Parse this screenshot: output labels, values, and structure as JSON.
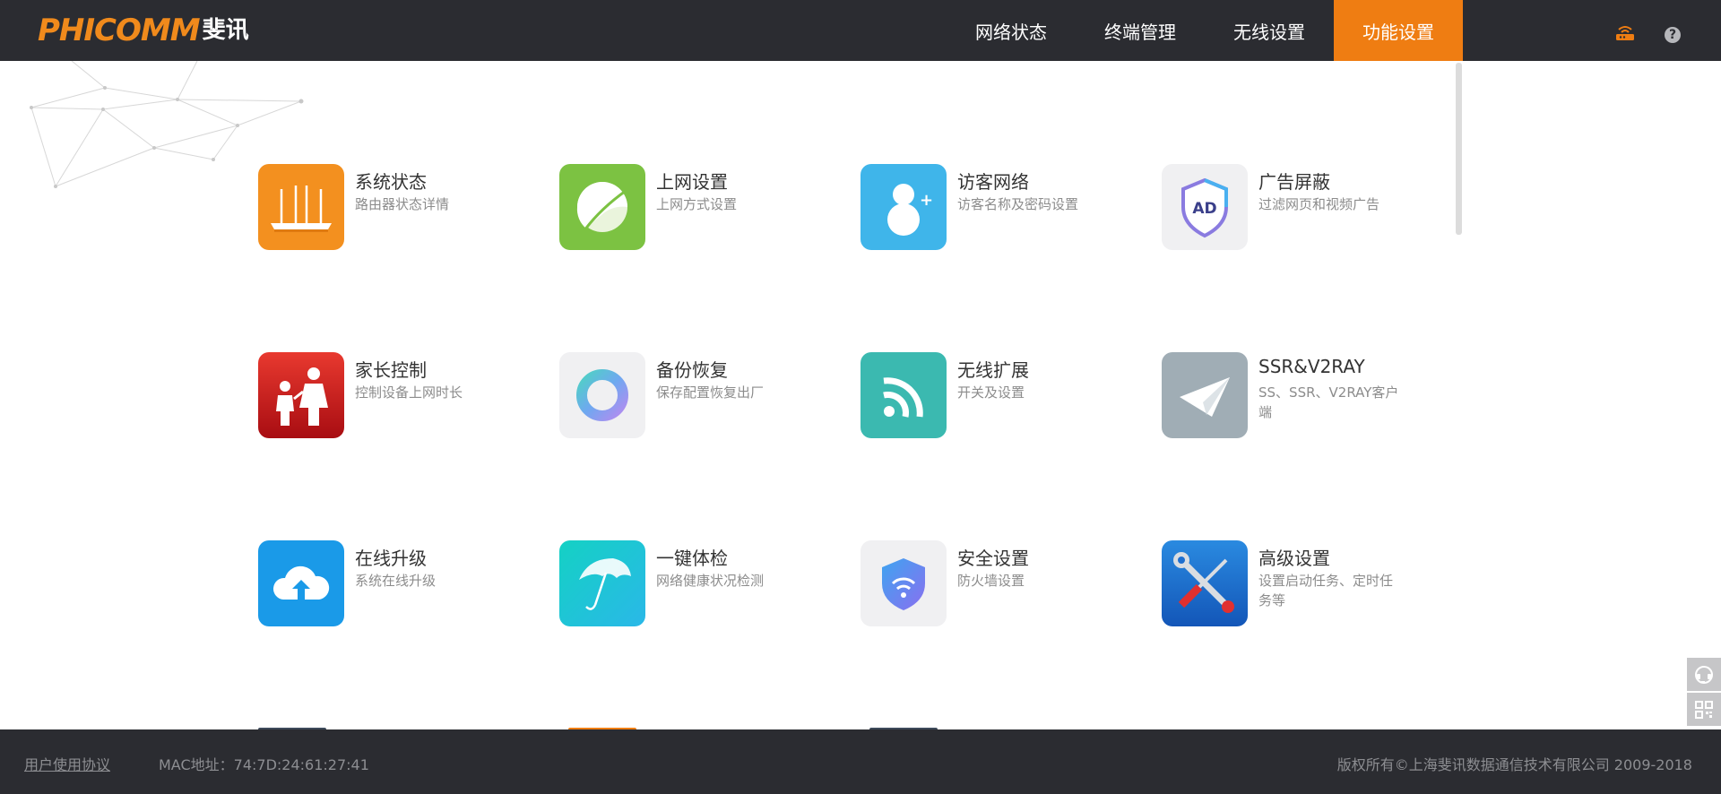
{
  "header": {
    "logo_en": "PHICOMM",
    "logo_cn": "斐讯",
    "nav": [
      {
        "label": "网络状态",
        "active": false
      },
      {
        "label": "终端管理",
        "active": false
      },
      {
        "label": "无线设置",
        "active": false
      },
      {
        "label": "功能设置",
        "active": true
      }
    ],
    "icons": {
      "router_status": "router-icon",
      "help": "?"
    }
  },
  "tiles": [
    {
      "title": "系统状态",
      "desc": "路由器状态详情",
      "icon": "router-icon",
      "color": "#f3901f"
    },
    {
      "title": "上网设置",
      "desc": "上网方式设置",
      "icon": "leaf-icon",
      "color": "#7cc242"
    },
    {
      "title": "访客网络",
      "desc": "访客名称及密码设置",
      "icon": "guest-icon",
      "color": "#3fb5ea"
    },
    {
      "title": "广告屏蔽",
      "desc": "过滤网页和视频广告",
      "icon": "ad-shield-icon",
      "color": "#f0f0f2"
    },
    {
      "title": "家长控制",
      "desc": "控制设备上网时长",
      "icon": "parent-child-icon",
      "color": "#c9161c"
    },
    {
      "title": "备份恢复",
      "desc": "保存配置恢复出厂",
      "icon": "backup-ring-icon",
      "color": "#f0f0f2"
    },
    {
      "title": "无线扩展",
      "desc": "开关及设置",
      "icon": "wireless-signal-icon",
      "color": "#3bb9b0"
    },
    {
      "title": "SSR&V2RAY",
      "desc": "SS、SSR、V2RAY客户端",
      "icon": "paper-plane-icon",
      "color": "#a0adb5"
    },
    {
      "title": "在线升级",
      "desc": "系统在线升级",
      "icon": "cloud-upload-icon",
      "color": "#1a9ae8"
    },
    {
      "title": "一键体检",
      "desc": "网络健康状况检测",
      "icon": "umbrella-icon",
      "color": "#22c9d6"
    },
    {
      "title": "安全设置",
      "desc": "防火墙设置",
      "icon": "security-shield-icon",
      "color": "#f0f0f2"
    },
    {
      "title": "高级设置",
      "desc": "设置启动任务、定时任务等",
      "icon": "tools-icon",
      "color": "#1f6fcf"
    }
  ],
  "side_buttons": [
    "support-icon",
    "qrcode-icon"
  ],
  "footer": {
    "agreement": "用户使用协议",
    "mac": "MAC地址：74:7D:24:61:27:41",
    "copyright": "版权所有©上海斐讯数据通信技术有限公司 2009-2018"
  }
}
